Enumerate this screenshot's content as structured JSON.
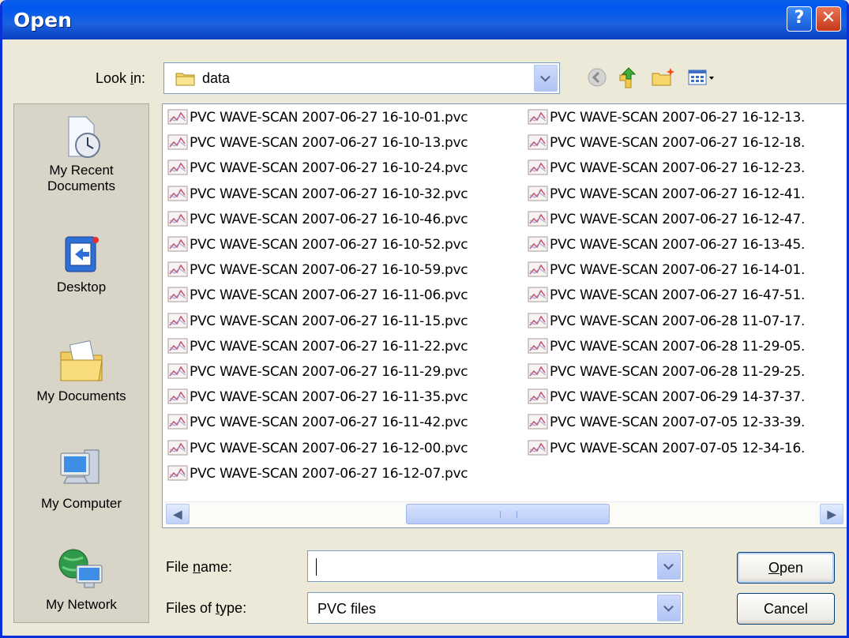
{
  "window": {
    "title": "Open",
    "help_glyph": "?",
    "close_glyph": "✕"
  },
  "look_in": {
    "label": "Look in:",
    "value": "data"
  },
  "places": [
    {
      "label": "My Recent Documents",
      "icon": "recent-documents-icon"
    },
    {
      "label": "Desktop",
      "icon": "desktop-icon"
    },
    {
      "label": "My Documents",
      "icon": "my-documents-icon"
    },
    {
      "label": "My Computer",
      "icon": "my-computer-icon"
    },
    {
      "label": "My Network",
      "icon": "my-network-icon"
    }
  ],
  "files_col1": [
    "PVC WAVE-SCAN 2007-06-27 16-10-01.pvc",
    "PVC WAVE-SCAN 2007-06-27 16-10-13.pvc",
    "PVC WAVE-SCAN 2007-06-27 16-10-24.pvc",
    "PVC WAVE-SCAN 2007-06-27 16-10-32.pvc",
    "PVC WAVE-SCAN 2007-06-27 16-10-46.pvc",
    "PVC WAVE-SCAN 2007-06-27 16-10-52.pvc",
    "PVC WAVE-SCAN 2007-06-27 16-10-59.pvc",
    "PVC WAVE-SCAN 2007-06-27 16-11-06.pvc",
    "PVC WAVE-SCAN 2007-06-27 16-11-15.pvc",
    "PVC WAVE-SCAN 2007-06-27 16-11-22.pvc",
    "PVC WAVE-SCAN 2007-06-27 16-11-29.pvc",
    "PVC WAVE-SCAN 2007-06-27 16-11-35.pvc",
    "PVC WAVE-SCAN 2007-06-27 16-11-42.pvc",
    "PVC WAVE-SCAN 2007-06-27 16-12-00.pvc",
    "PVC WAVE-SCAN 2007-06-27 16-12-07.pvc"
  ],
  "files_col2": [
    "PVC WAVE-SCAN 2007-06-27 16-12-13.",
    "PVC WAVE-SCAN 2007-06-27 16-12-18.",
    "PVC WAVE-SCAN 2007-06-27 16-12-23.",
    "PVC WAVE-SCAN 2007-06-27 16-12-41.",
    "PVC WAVE-SCAN 2007-06-27 16-12-47.",
    "PVC WAVE-SCAN 2007-06-27 16-13-45.",
    "PVC WAVE-SCAN 2007-06-27 16-14-01.",
    "PVC WAVE-SCAN 2007-06-27 16-47-51.",
    "PVC WAVE-SCAN 2007-06-28 11-07-17.",
    "PVC WAVE-SCAN 2007-06-28 11-29-05.",
    "PVC WAVE-SCAN 2007-06-28 11-29-25.",
    "PVC WAVE-SCAN 2007-06-29 14-37-37.",
    "PVC WAVE-SCAN 2007-07-05 12-33-39.",
    "PVC WAVE-SCAN 2007-07-05 12-34-16."
  ],
  "file_name": {
    "label_pre": "File ",
    "label_key": "n",
    "label_post": "ame:",
    "value": ""
  },
  "file_type": {
    "label_pre": "Files of ",
    "label_key": "t",
    "label_post": "ype:",
    "value": "PVC files"
  },
  "buttons": {
    "open_key": "O",
    "open_rest": "pen",
    "cancel": "Cancel"
  },
  "scroll": {
    "left": "◀",
    "right": "▶"
  }
}
